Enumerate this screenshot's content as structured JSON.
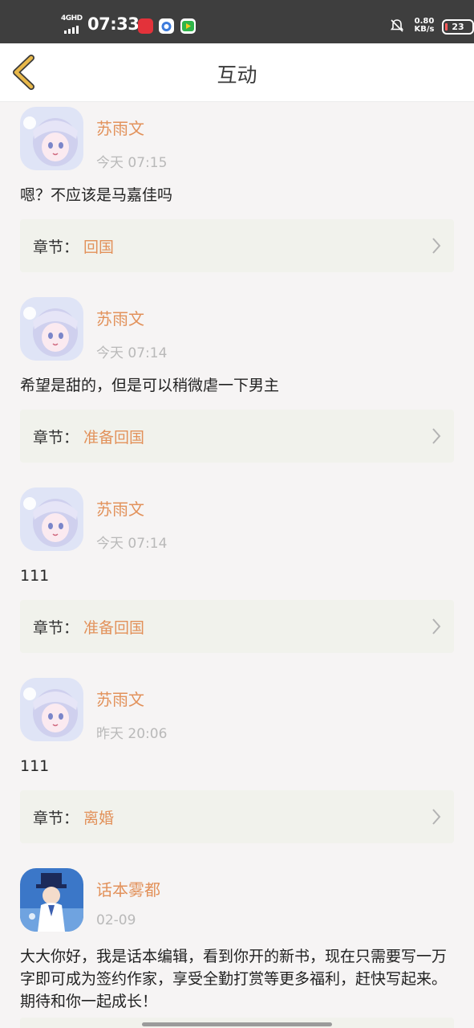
{
  "status_bar": {
    "network": "4GHD",
    "time": "07:33",
    "speed_value": "0.80",
    "speed_unit": "KB/s",
    "battery": "23",
    "icons": [
      "app-icon-red",
      "app-icon-blue",
      "app-icon-green",
      "mute-bell-icon",
      "battery-icon"
    ]
  },
  "header": {
    "title": "互动",
    "back_icon": "chevron-left-icon",
    "accent_color": "#e8b84a"
  },
  "colors": {
    "username": "#e2915a",
    "chapter_name": "#e2915a",
    "chapter_bg": "#f1f2ec",
    "page_bg": "#f6f4f4"
  },
  "comments": [
    {
      "user": "苏雨文",
      "time": "今天 07:15",
      "text": "嗯？不应该是马嘉佳吗",
      "chapter_label": "章节：",
      "chapter": "回国",
      "avatar": "anime-girl-avatar"
    },
    {
      "user": "苏雨文",
      "time": "今天 07:14",
      "text": "希望是甜的，但是可以稍微虐一下男主",
      "chapter_label": "章节：",
      "chapter": "准备回国",
      "avatar": "anime-girl-avatar"
    },
    {
      "user": "苏雨文",
      "time": "今天 07:14",
      "text": "111",
      "chapter_label": "章节：",
      "chapter": "准备回国",
      "avatar": "anime-girl-avatar"
    },
    {
      "user": "苏雨文",
      "time": "昨天 20:06",
      "text": "111",
      "chapter_label": "章节：",
      "chapter": "离婚",
      "avatar": "anime-girl-avatar"
    },
    {
      "user": "话本雾都",
      "time": "02-09",
      "text": "大大你好，我是话本编辑，看到你开的新书，现在只需要写一万字即可成为签约作家，享受全勤打赏等更多福利，赶快写起来。期待和你一起成长！",
      "avatar": "anime-magician-avatar"
    }
  ]
}
